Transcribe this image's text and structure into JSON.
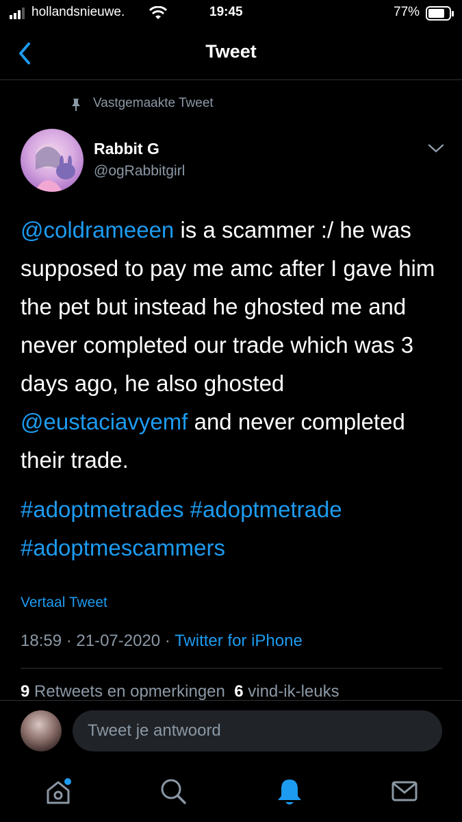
{
  "status_bar": {
    "carrier": "hollandsnieuwe.",
    "time": "19:45",
    "battery": "77%"
  },
  "header": {
    "title": "Tweet"
  },
  "tweet": {
    "pinned_label": "Vastgemaakte Tweet",
    "author_name": "Rabbit G",
    "author_handle": "@ogRabbitgirl",
    "body": {
      "mention1": "@coldrameeen",
      "part1": " is a scammer :/ he was supposed to pay me amc after I gave him the pet but instead he ghosted me and never completed our trade which was 3 days ago, he also ghosted ",
      "mention2": "@eustaciavyemf",
      "part2": " and never completed their trade."
    },
    "hashtags": [
      "#adoptmetrades",
      "#adoptmetrade",
      "#adoptmescammers"
    ],
    "translate_label": "Vertaal Tweet",
    "time": "18:59",
    "date": "21-07-2020",
    "source": "Twitter for iPhone",
    "retweets_count": "9",
    "retweets_label": "Retweets en opmerkingen",
    "likes_count": "6",
    "likes_label": "vind-ik-leuks"
  },
  "reply": {
    "placeholder": "Tweet je antwoord"
  },
  "tabs": [
    "home-icon",
    "search-icon",
    "notifications-icon",
    "messages-icon"
  ],
  "colors": {
    "accent": "#1d9bf0",
    "muted": "#8b98a5",
    "background": "#000000"
  }
}
